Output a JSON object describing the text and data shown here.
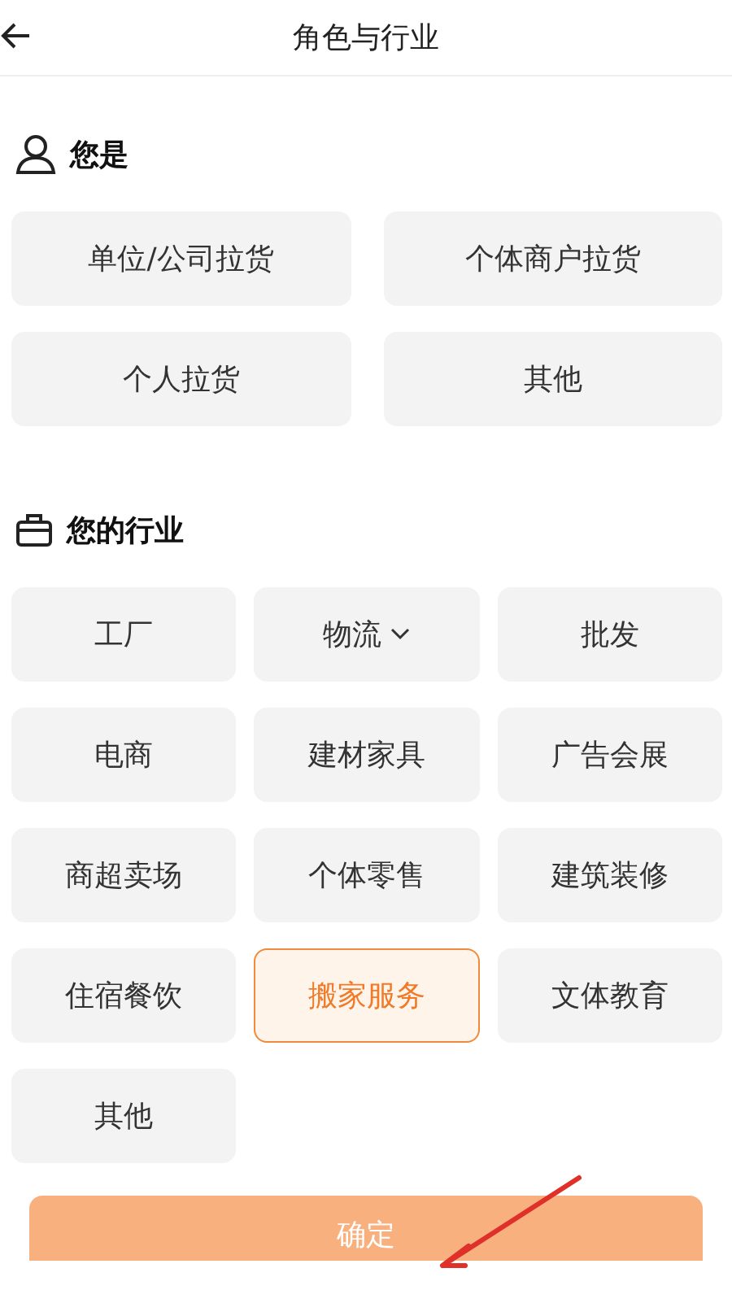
{
  "header": {
    "title": "角色与行业"
  },
  "role_section": {
    "title": "您是",
    "options": [
      {
        "label": "单位/公司拉货",
        "selected": false
      },
      {
        "label": "个体商户拉货",
        "selected": false
      },
      {
        "label": "个人拉货",
        "selected": false
      },
      {
        "label": "其他",
        "selected": false
      }
    ]
  },
  "industry_section": {
    "title": "您的行业",
    "options": [
      {
        "label": "工厂",
        "selected": false,
        "kind": "plain"
      },
      {
        "label": "物流",
        "selected": false,
        "kind": "dropdown"
      },
      {
        "label": "批发",
        "selected": false,
        "kind": "plain"
      },
      {
        "label": "电商",
        "selected": false,
        "kind": "plain"
      },
      {
        "label": "建材家具",
        "selected": false,
        "kind": "plain"
      },
      {
        "label": "广告会展",
        "selected": false,
        "kind": "plain"
      },
      {
        "label": "商超卖场",
        "selected": false,
        "kind": "plain"
      },
      {
        "label": "个体零售",
        "selected": false,
        "kind": "plain"
      },
      {
        "label": "建筑装修",
        "selected": false,
        "kind": "plain"
      },
      {
        "label": "住宿餐饮",
        "selected": false,
        "kind": "plain"
      },
      {
        "label": "搬家服务",
        "selected": true,
        "kind": "plain"
      },
      {
        "label": "文体教育",
        "selected": false,
        "kind": "plain"
      },
      {
        "label": "其他",
        "selected": false,
        "kind": "plain"
      }
    ]
  },
  "confirm_button": {
    "label": "确定"
  }
}
